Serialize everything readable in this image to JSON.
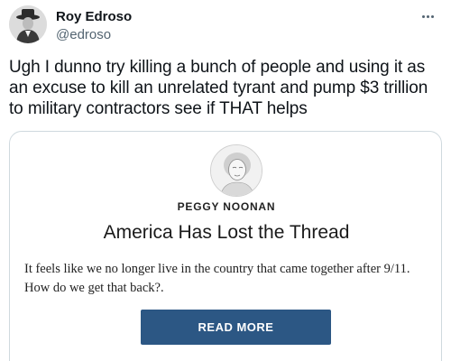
{
  "author": {
    "display_name": "Roy Edroso",
    "handle": "@edroso",
    "avatar_icon": "user-avatar-icon",
    "more_icon": "more-options-icon"
  },
  "tweet": {
    "text": "Ugh I dunno try killing a bunch of people and using it as an excuse to kill an unrelated tyrant and pump $3 trillion to military contractors see if THAT helps"
  },
  "card": {
    "portrait_icon": "author-portrait-icon",
    "author": "PEGGY NOONAN",
    "headline": "America Has Lost the Thread",
    "summary": "It feels like we no longer live in the country that came together after 9/11. How do we get that back?.",
    "button_label": "READ MORE",
    "button_color": "#2c5784"
  },
  "colors": {
    "text_primary": "#0f1419",
    "text_secondary": "#536471",
    "card_border": "#cfd9de"
  }
}
